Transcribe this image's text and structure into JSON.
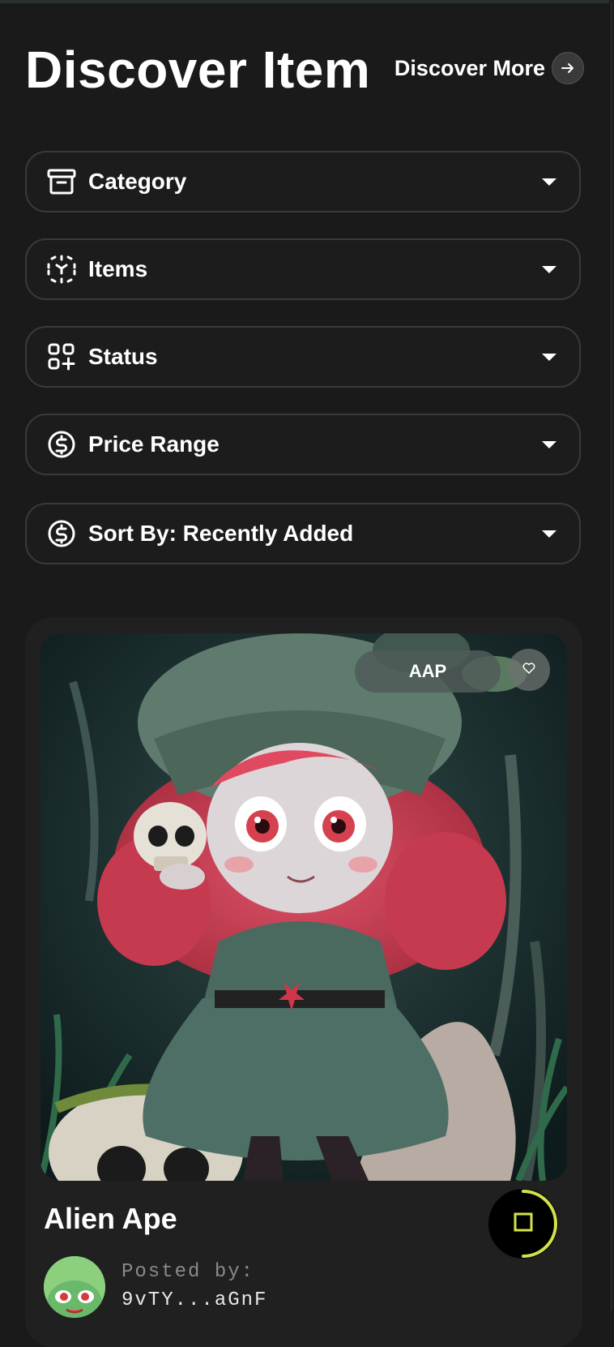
{
  "header": {
    "title": "Discover Item",
    "discover_more_label": "Discover More"
  },
  "filters": [
    {
      "label": "Category",
      "icon": "archive-box-icon"
    },
    {
      "label": "Items",
      "icon": "scan-cube-icon"
    },
    {
      "label": "Status",
      "icon": "apps-grid-plus-icon"
    },
    {
      "label": "Price Range",
      "icon": "dollar-circle-icon"
    },
    {
      "label": "Sort By: Recently Added",
      "icon": "dollar-circle-icon"
    }
  ],
  "card": {
    "tag": "AAP",
    "name": "Alien Ape",
    "posted_by_label": "Posted by:",
    "posted_by_user": "9vTY...aGnF",
    "accent_color": "#d4e24a"
  },
  "colors": {
    "background": "#1a1a1a",
    "card": "#202020",
    "border": "#3a3a3a"
  }
}
